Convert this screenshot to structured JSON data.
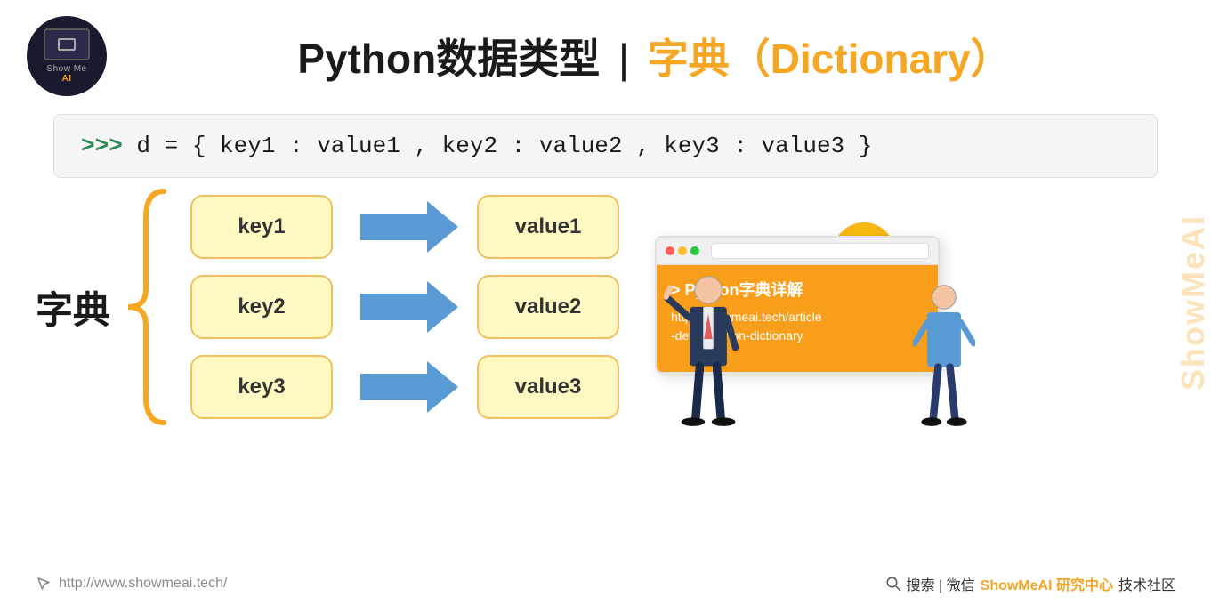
{
  "header": {
    "logo": {
      "show_text": "Show",
      "me_text": "Me",
      "ai_text": "AI"
    },
    "title_prefix": "Python数据类型",
    "title_separator": "|",
    "title_highlight": "字典（Dictionary）"
  },
  "code": {
    "prompt": ">>>",
    "content": " d = { key1 : value1 , key2 : value2 , key3 : value3 }"
  },
  "dict_label": "字典",
  "keys": [
    "key1",
    "key2",
    "key3"
  ],
  "values": [
    "value1",
    "value2",
    "value3"
  ],
  "browser": {
    "title": "> Python字典详解",
    "url_line1": "http://showmeai.tech/article",
    "url_line2": "-detail/python-dictionary"
  },
  "footer": {
    "url": "http://www.showmeai.tech/",
    "search_label": "搜索 | 微信",
    "brand": "ShowMeAI 研究中心",
    "community": "技术社区"
  },
  "watermark": "ShowMeAI"
}
